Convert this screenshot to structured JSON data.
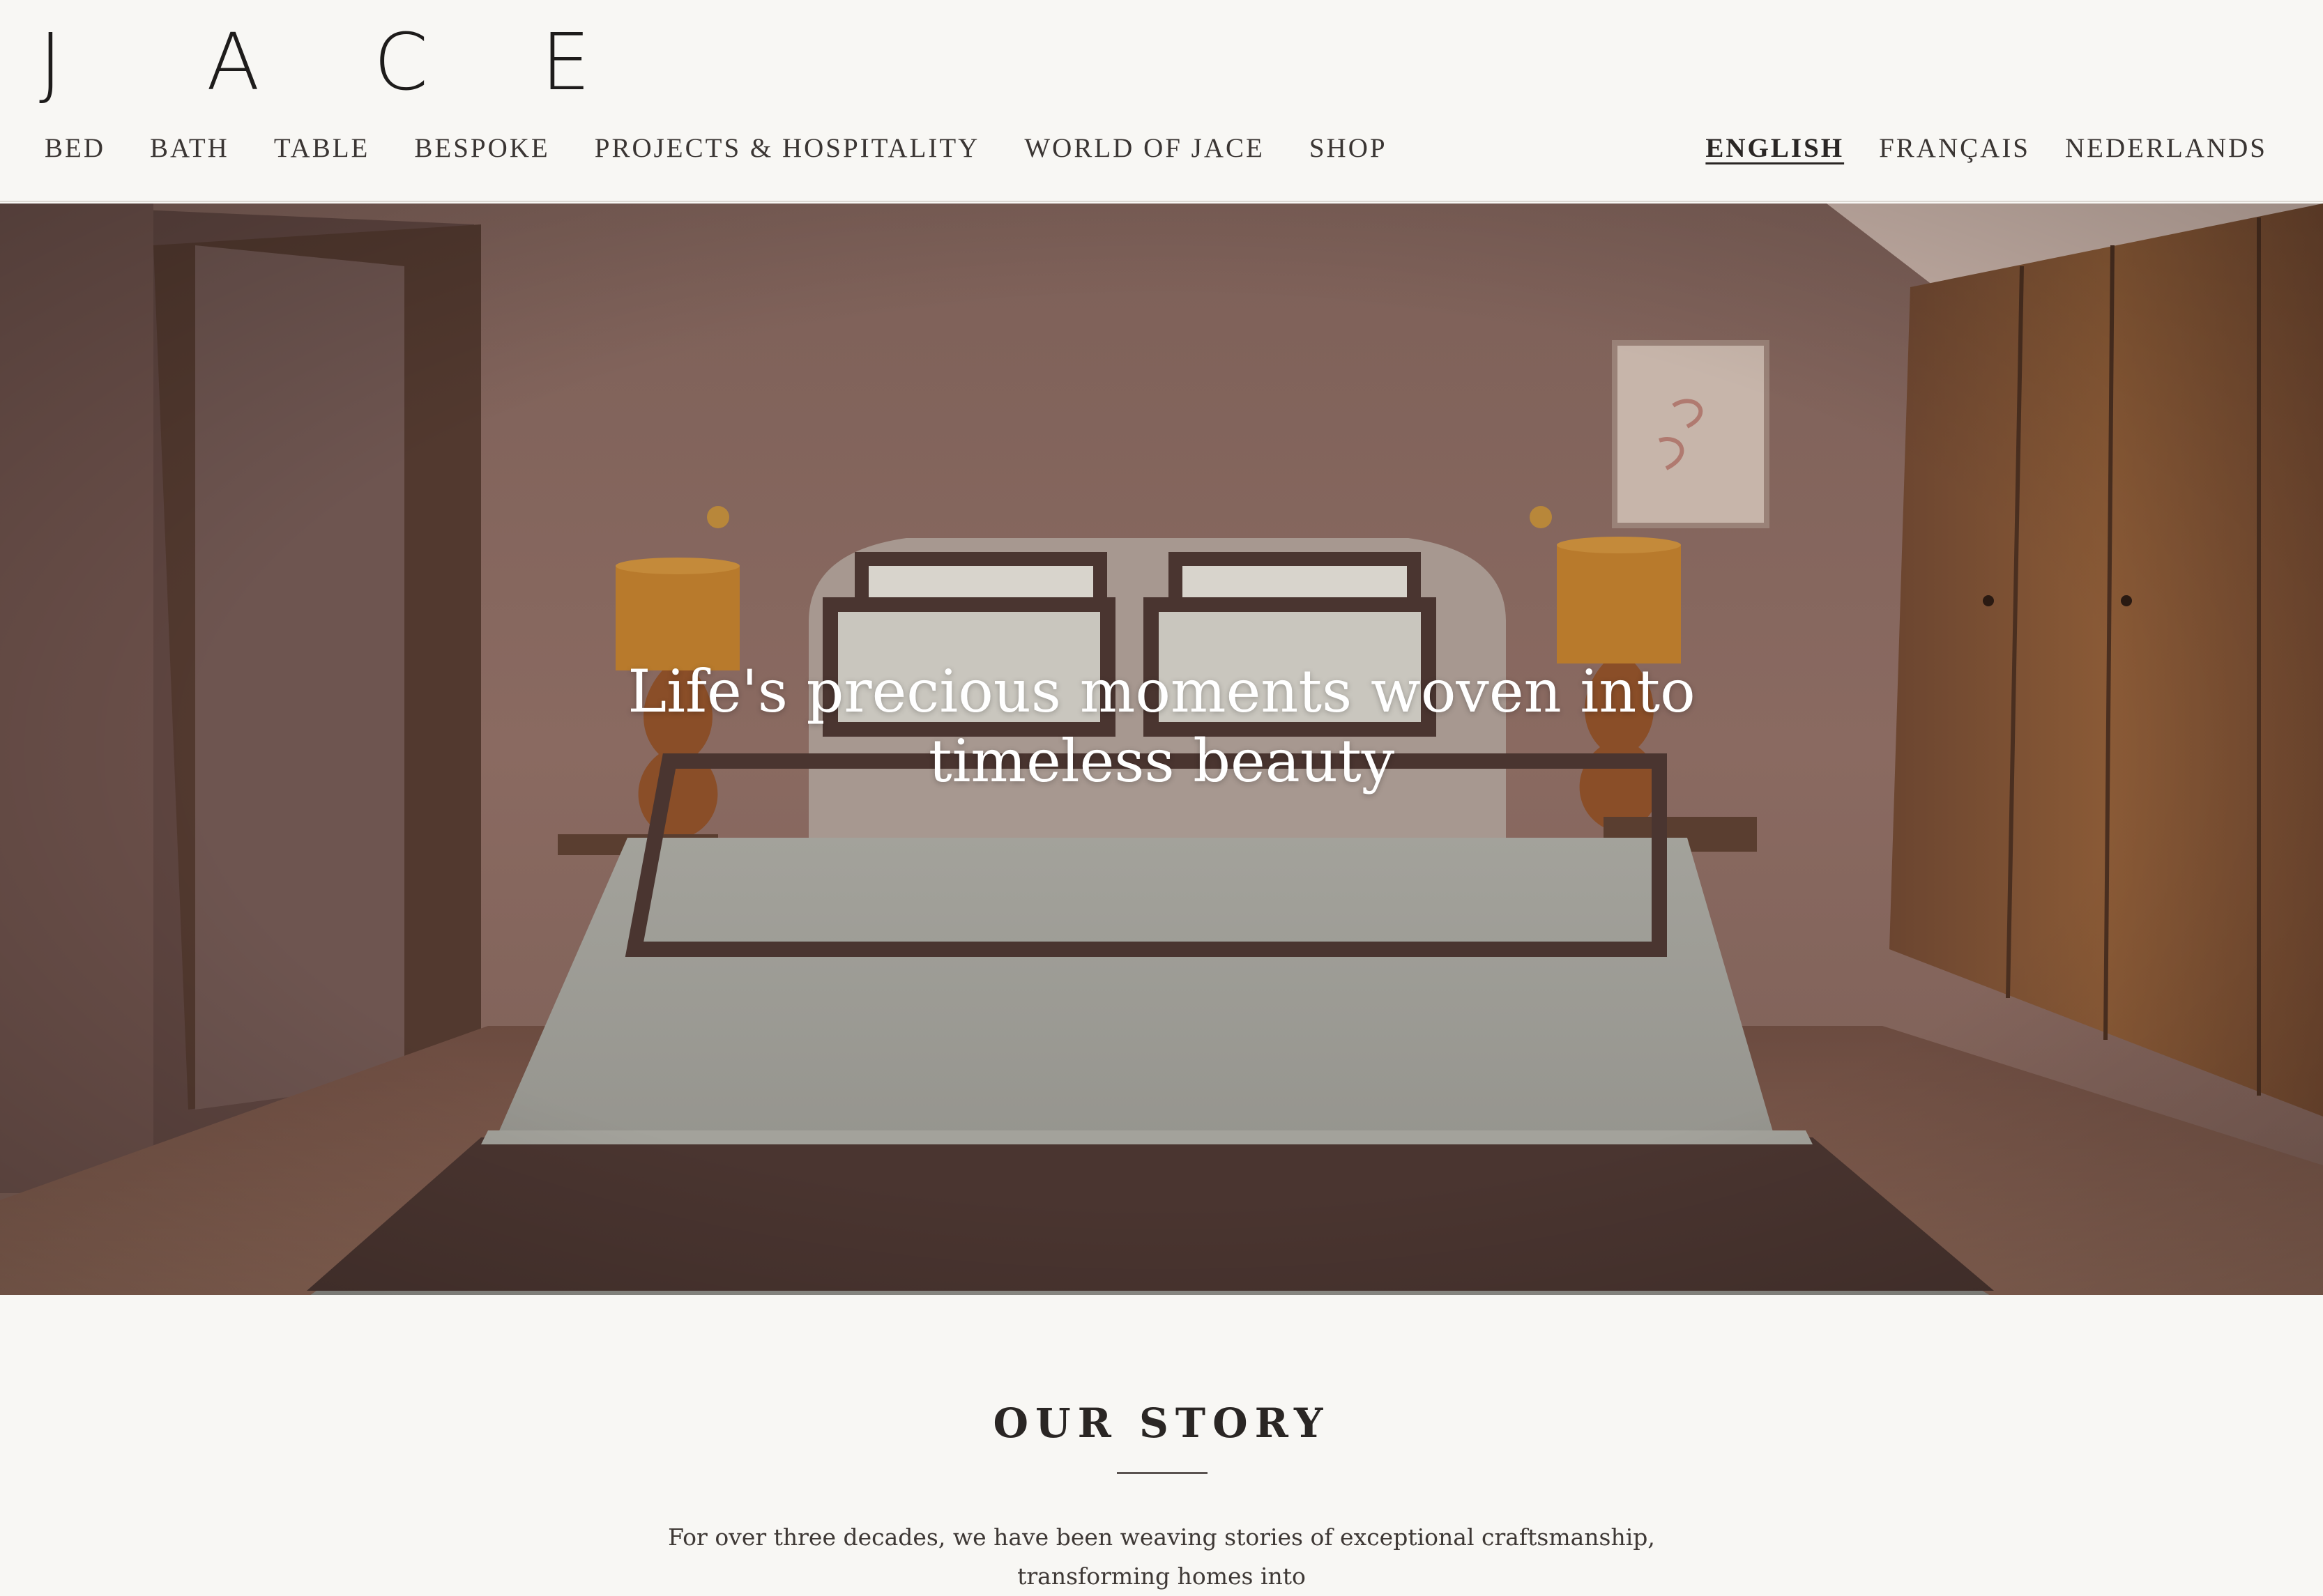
{
  "brand": {
    "logo_letters": [
      "J",
      "A",
      "C",
      "E"
    ]
  },
  "nav": {
    "items": [
      {
        "label": "BED"
      },
      {
        "label": "BATH"
      },
      {
        "label": "TABLE"
      },
      {
        "label": "BESPOKE"
      },
      {
        "label": "PROJECTS & HOSPITALITY"
      },
      {
        "label": "WORLD OF JACE"
      },
      {
        "label": "SHOP"
      }
    ]
  },
  "languages": {
    "items": [
      {
        "label": "ENGLISH",
        "active": true
      },
      {
        "label": "FRANÇAIS",
        "active": false
      },
      {
        "label": "NEDERLANDS",
        "active": false
      }
    ]
  },
  "hero": {
    "title_line1": "Life's precious moments woven into",
    "title_line2": "timeless beauty"
  },
  "story": {
    "heading": "OUR STORY",
    "text": "For over three decades, we have been weaving stories of exceptional craftsmanship, transforming homes into"
  },
  "colors": {
    "background": "#f8f7f4",
    "text": "#2a2624",
    "bed_trim": "#4a3530",
    "wood": "#8a5a36",
    "lamp_shade": "#b87a2c"
  }
}
